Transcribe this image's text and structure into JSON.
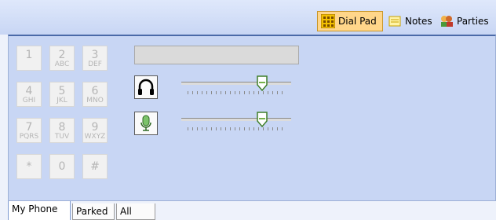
{
  "toolbar": {
    "dial_pad_label": "Dial Pad",
    "notes_label": "Notes",
    "parties_label": "Parties",
    "icons": [
      "dial-pad-icon",
      "notes-icon",
      "parties-icon"
    ]
  },
  "keypad": [
    {
      "digit": "1",
      "letters": ""
    },
    {
      "digit": "2",
      "letters": "ABC"
    },
    {
      "digit": "3",
      "letters": "DEF"
    },
    {
      "digit": "4",
      "letters": "GHI"
    },
    {
      "digit": "5",
      "letters": "JKL"
    },
    {
      "digit": "6",
      "letters": "MNO"
    },
    {
      "digit": "7",
      "letters": "PQRS"
    },
    {
      "digit": "8",
      "letters": "TUV"
    },
    {
      "digit": "9",
      "letters": "WXYZ"
    },
    {
      "digit": "*",
      "letters": ""
    },
    {
      "digit": "0",
      "letters": ""
    },
    {
      "digit": "#",
      "letters": ""
    }
  ],
  "number_display": {
    "value": ""
  },
  "controls": {
    "speaker_icon": "headphones-icon",
    "speaker_volume": 0.76,
    "mic_icon": "microphone-icon",
    "mic_volume": 0.76
  },
  "tabs": [
    {
      "label": "My Phone",
      "active": true
    },
    {
      "label": "Parked",
      "active": false
    },
    {
      "label": "All",
      "active": false
    }
  ],
  "colors": {
    "active_tab_accent": "#ffd68a",
    "panel": "#c8d6f4"
  }
}
